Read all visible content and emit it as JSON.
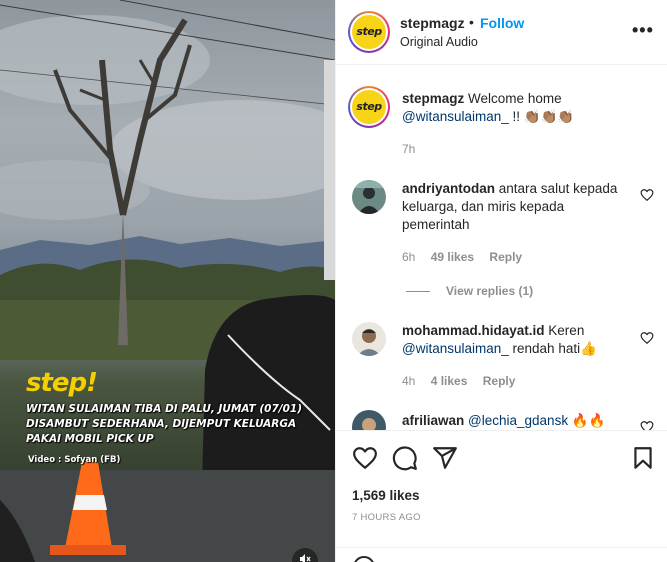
{
  "media": {
    "overlay_logo": "step!",
    "overlay_caption": "WITAN SULAIMAN TIBA DI PALU, JUMAT (07/01) DISAMBUT SEDERHANA, DIJEMPUT KELUARGA PAKAI MOBIL PICK UP",
    "overlay_credit": "Video : Sofyan (FB)",
    "mute_icon": "speaker-muted-icon"
  },
  "header": {
    "avatar_text": "step",
    "username": "stepmagz",
    "separator": "•",
    "follow_label": "Follow",
    "audio_label": "Original Audio",
    "more_icon": "more-horizontal-icon",
    "more_glyph": "•••"
  },
  "caption": {
    "avatar_text": "step",
    "username": "stepmagz",
    "text_before": "Welcome home",
    "mention": "@witansulaiman_",
    "text_after": "!! 👏🏽👏🏽👏🏽",
    "time": "7h"
  },
  "comments": [
    {
      "username": "andriyantodan",
      "text": "antara salut kepada keluarga, dan miris kepada pemerintah",
      "time": "6h",
      "likes": "49 likes",
      "reply": "Reply",
      "view_replies": "View replies (1)"
    },
    {
      "username": "mohammad.hidayat.id",
      "text_before": "Keren",
      "mention": "@witansulaiman_",
      "text_after": "rendah hati👍",
      "time": "4h",
      "likes": "4 likes",
      "reply": "Reply"
    },
    {
      "username": "afriliawan",
      "mention": "@lechia_gdansk",
      "text_after": "🔥🔥"
    }
  ],
  "actions": {
    "like_icon": "heart-icon",
    "comment_icon": "comment-icon",
    "share_icon": "send-icon",
    "save_icon": "bookmark-icon",
    "likes": "1,569 likes",
    "time_ago": "7 HOURS AGO"
  },
  "colors": {
    "accent": "#0095f6",
    "mention": "#00376b",
    "muted": "#8e8e8e",
    "brand_yellow": "#f7d417"
  }
}
